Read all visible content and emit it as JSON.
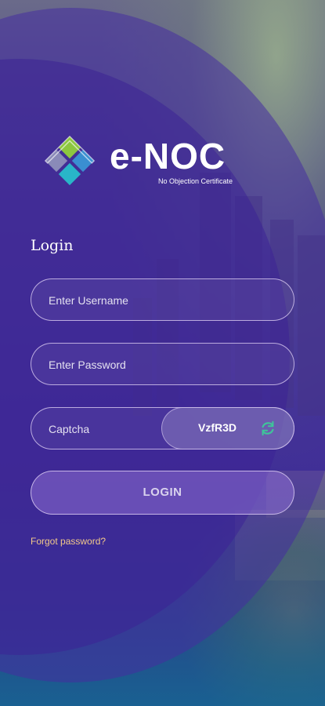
{
  "brand": {
    "name": "e-NOC",
    "tagline": "No Objection Certificate",
    "icon": "enoc-logo-mark"
  },
  "login": {
    "title": "Login",
    "username_placeholder": "Enter Username",
    "password_placeholder": "Enter Password",
    "captcha_placeholder": "Captcha",
    "captcha_code": "VzfR3D",
    "refresh_icon": "refresh-icon",
    "submit_label": "LOGIN",
    "forgot_label": "Forgot password?"
  },
  "colors": {
    "accent": "#f3c98a",
    "refresh": "#3fc49a",
    "overlay": "#3a2c86"
  }
}
